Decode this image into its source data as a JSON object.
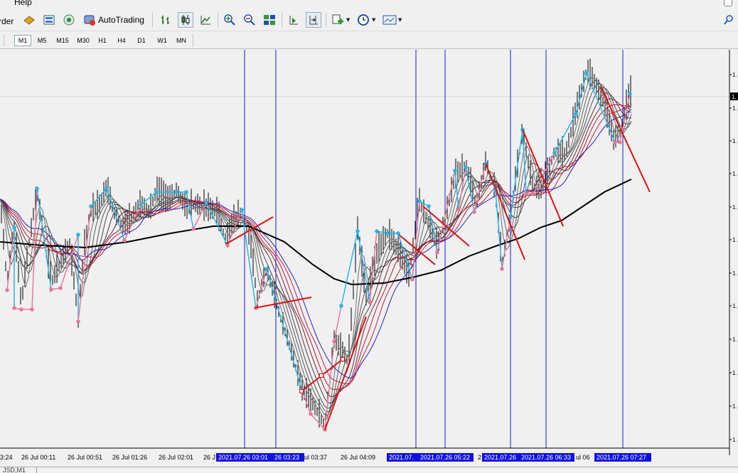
{
  "menu": {
    "help": "Help"
  },
  "toolbar": {
    "order_label": "rder",
    "autotrading_label": "AutoTrading"
  },
  "timeframes": [
    "M1",
    "M5",
    "M15",
    "M30",
    "H1",
    "H4",
    "D1",
    "W1",
    "MN"
  ],
  "active_timeframe": "M1",
  "time_axis": {
    "labels": [
      "3:24",
      "26 Jul 00:11",
      "26 Jul 00:51",
      "26 Jul 01:26",
      "26 Jul 02:01",
      "26 J",
      "ul 03:37",
      "26 Jul 04:09",
      "2"
    ],
    "highlights": [
      "2021.07.26 03:01",
      "26 03:23",
      "2021.07.",
      "2021.07.26 05:22",
      "2021.07.26",
      "2021.07.26 06:33",
      "2021.07.26 07:27"
    ],
    "extra": "ul 06"
  },
  "price_axis": {
    "label": "1.",
    "current_label": "1."
  },
  "bottom_tab": "JSD,M1",
  "colors": {
    "background": "#f0f0f0",
    "candle": "#000000",
    "ma_slow": "#000000",
    "fan_upper": "#555555",
    "fan_lower": "#c0203a",
    "fan_base": "#2020c0",
    "zigzag_top": "#27b4e8",
    "zigzag_bottom": "#e8789a",
    "trendline": "#e01010",
    "session_line": "#1a1acc",
    "highlight": "#1010e0"
  }
}
